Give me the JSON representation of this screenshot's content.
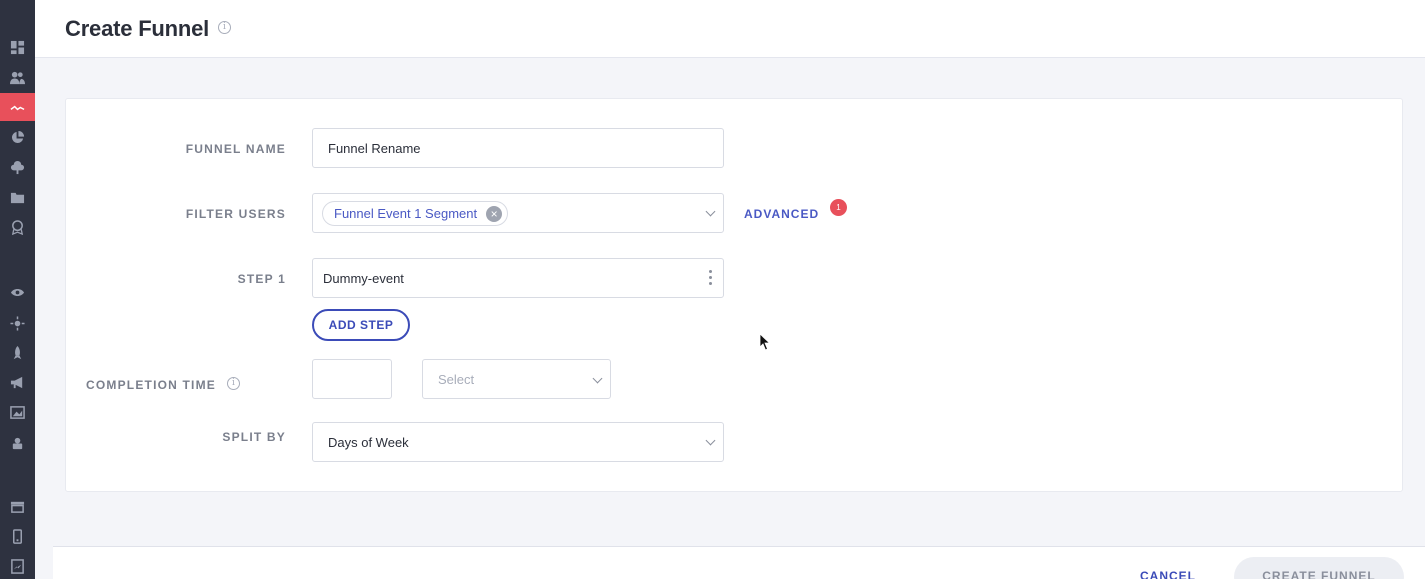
{
  "header": {
    "title": "Create Funnel",
    "info_icon": "info-icon"
  },
  "sidebar": {
    "items": [
      {
        "icon": "dashboard-icon",
        "active": false
      },
      {
        "icon": "users-icon",
        "active": false
      },
      {
        "icon": "funnel-trend-icon",
        "active": true
      },
      {
        "icon": "pie-chart-icon",
        "active": false
      },
      {
        "icon": "cloud-upload-icon",
        "active": false
      },
      {
        "icon": "folder-icon",
        "active": false
      },
      {
        "icon": "badge-icon",
        "active": false
      },
      {
        "icon": "eye-icon",
        "active": false
      },
      {
        "icon": "settings-sun-icon",
        "active": false
      },
      {
        "icon": "rocket-icon",
        "active": false
      },
      {
        "icon": "megaphone-icon",
        "active": false
      },
      {
        "icon": "image-icon",
        "active": false
      },
      {
        "icon": "plugin-icon",
        "active": false
      },
      {
        "icon": "archive-icon",
        "active": false
      },
      {
        "icon": "mobile-icon",
        "active": false
      },
      {
        "icon": "report-icon",
        "active": false
      }
    ],
    "accent_color": "#e8505b"
  },
  "form": {
    "funnel_name": {
      "label": "FUNNEL NAME",
      "value": "Funnel Rename"
    },
    "filter_users": {
      "label": "FILTER USERS",
      "chip": "Funnel Event 1 Segment",
      "advanced_label": "ADVANCED",
      "advanced_count": "1"
    },
    "step1": {
      "label": "STEP 1",
      "value": "Dummy-event"
    },
    "add_step_label": "ADD STEP",
    "completion_time": {
      "label": "COMPLETION TIME",
      "value": "",
      "unit_placeholder": "Select"
    },
    "split_by": {
      "label": "SPLIT BY",
      "value": "Days of Week"
    }
  },
  "footer": {
    "cancel_label": "CANCEL",
    "create_label": "CREATE FUNNEL"
  },
  "colors": {
    "primary": "#3b4bb8",
    "badge": "#e8505b"
  }
}
